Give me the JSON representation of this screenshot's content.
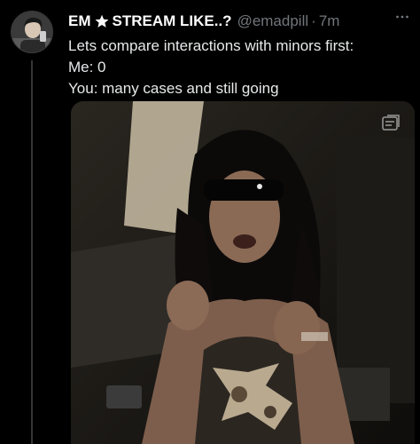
{
  "author": {
    "display_name": "EM",
    "name_suffix": "STREAM LIKE..?",
    "handle": "@emadpill",
    "separator": "·",
    "time": "7m"
  },
  "tweet": {
    "lines": [
      "Lets compare interactions with minors first:",
      "Me: 0",
      "You: many cases and still going"
    ]
  },
  "icons": {
    "avatar": "profile-photo",
    "verified_star": "star-icon",
    "more": "more-horizontal-icon",
    "media_badge": "gif-badge-icon"
  },
  "colors": {
    "background": "#000000",
    "text": "#e7e9ea",
    "secondary_text": "#71767b"
  }
}
